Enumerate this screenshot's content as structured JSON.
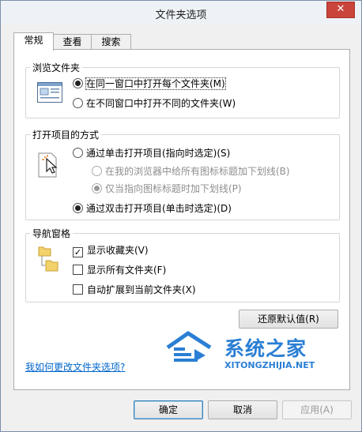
{
  "window": {
    "title": "文件夹选项",
    "close_glyph": "✕"
  },
  "tabs": [
    {
      "label": "常规",
      "active": true
    },
    {
      "label": "查看",
      "active": false
    },
    {
      "label": "搜索",
      "active": false
    }
  ],
  "browse_folders": {
    "title": "浏览文件夹",
    "options": [
      {
        "label": "在同一窗口中打开每个文件夹(M)",
        "selected": true
      },
      {
        "label": "在不同窗口中打开不同的文件夹(W)",
        "selected": false
      }
    ]
  },
  "click_items": {
    "title": "打开项目的方式",
    "single_click": {
      "label": "通过单击打开项目(指向时选定)(S)",
      "selected": false
    },
    "underline_options": [
      {
        "label": "在我的浏览器中给所有图标标题加下划线(B)",
        "selected": false,
        "enabled": false
      },
      {
        "label": "仅当指向图标标题时加下划线(P)",
        "selected": true,
        "enabled": false
      }
    ],
    "double_click": {
      "label": "通过双击打开项目(单击时选定)(D)",
      "selected": true
    }
  },
  "navigation_pane": {
    "title": "导航窗格",
    "options": [
      {
        "label": "显示收藏夹(V)",
        "checked": true,
        "check_glyph": "✓"
      },
      {
        "label": "显示所有文件夹(F)",
        "checked": false,
        "check_glyph": ""
      },
      {
        "label": "自动扩展到当前文件夹(X)",
        "checked": false,
        "check_glyph": ""
      }
    ]
  },
  "restore_defaults_label": "还原默认值(R)",
  "help_link": "我如何更改文件夹选项?",
  "footer": {
    "ok": "确定",
    "cancel": "取消",
    "apply": "应用(A)"
  },
  "watermark": {
    "brand": "系统之家",
    "url": "XITONGZHIJIA.NET"
  },
  "colors": {
    "link": "#0066cc",
    "close": "#c9443b",
    "watermark": "#2a7fd4"
  }
}
